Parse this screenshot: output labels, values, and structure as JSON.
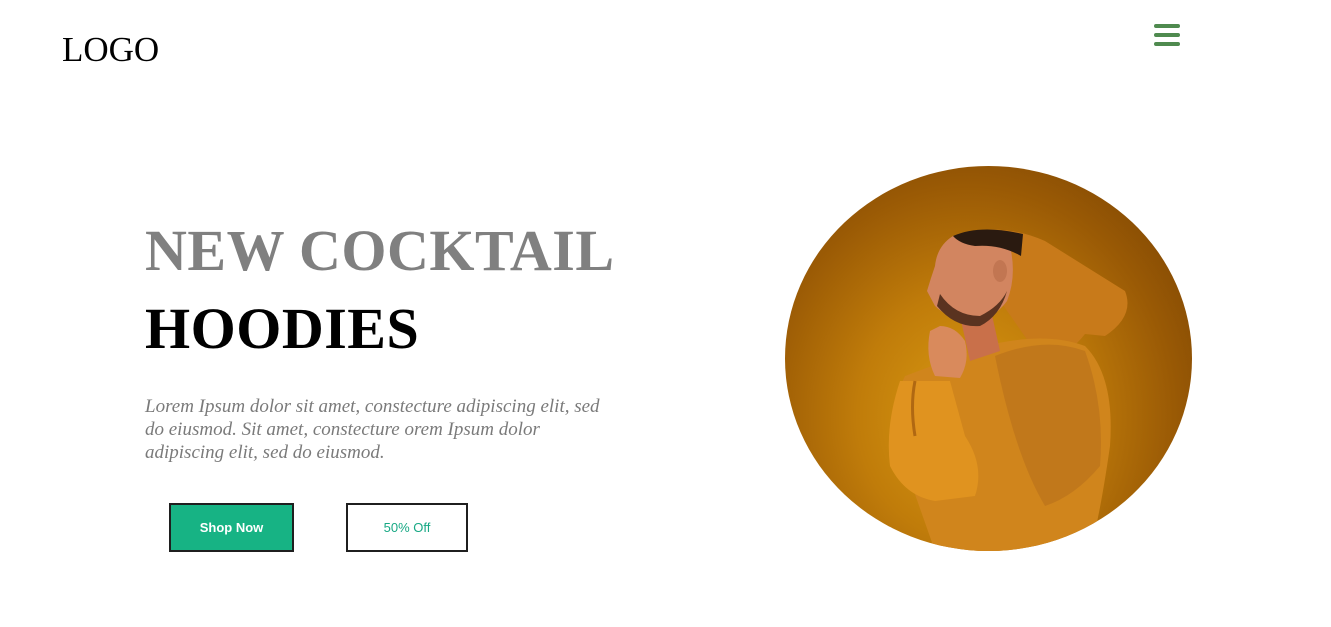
{
  "header": {
    "logo": "LOGO",
    "menu_icon": "hamburger-menu-icon",
    "accent_color": "#4f8a4f"
  },
  "hero": {
    "headline_1": "NEW COCKTAIL",
    "headline_2": "HOODIES",
    "description": "Lorem Ipsum dolor sit amet, constecture adipiscing elit, sed do eiusmod. Sit amet, constecture orem Ipsum dolor adipiscing elit, sed do eiusmod.",
    "buttons": {
      "shop_now": "Shop Now",
      "discount": "50% Off"
    },
    "colors": {
      "primary": "#17b384",
      "headline_gray": "#808080"
    }
  }
}
